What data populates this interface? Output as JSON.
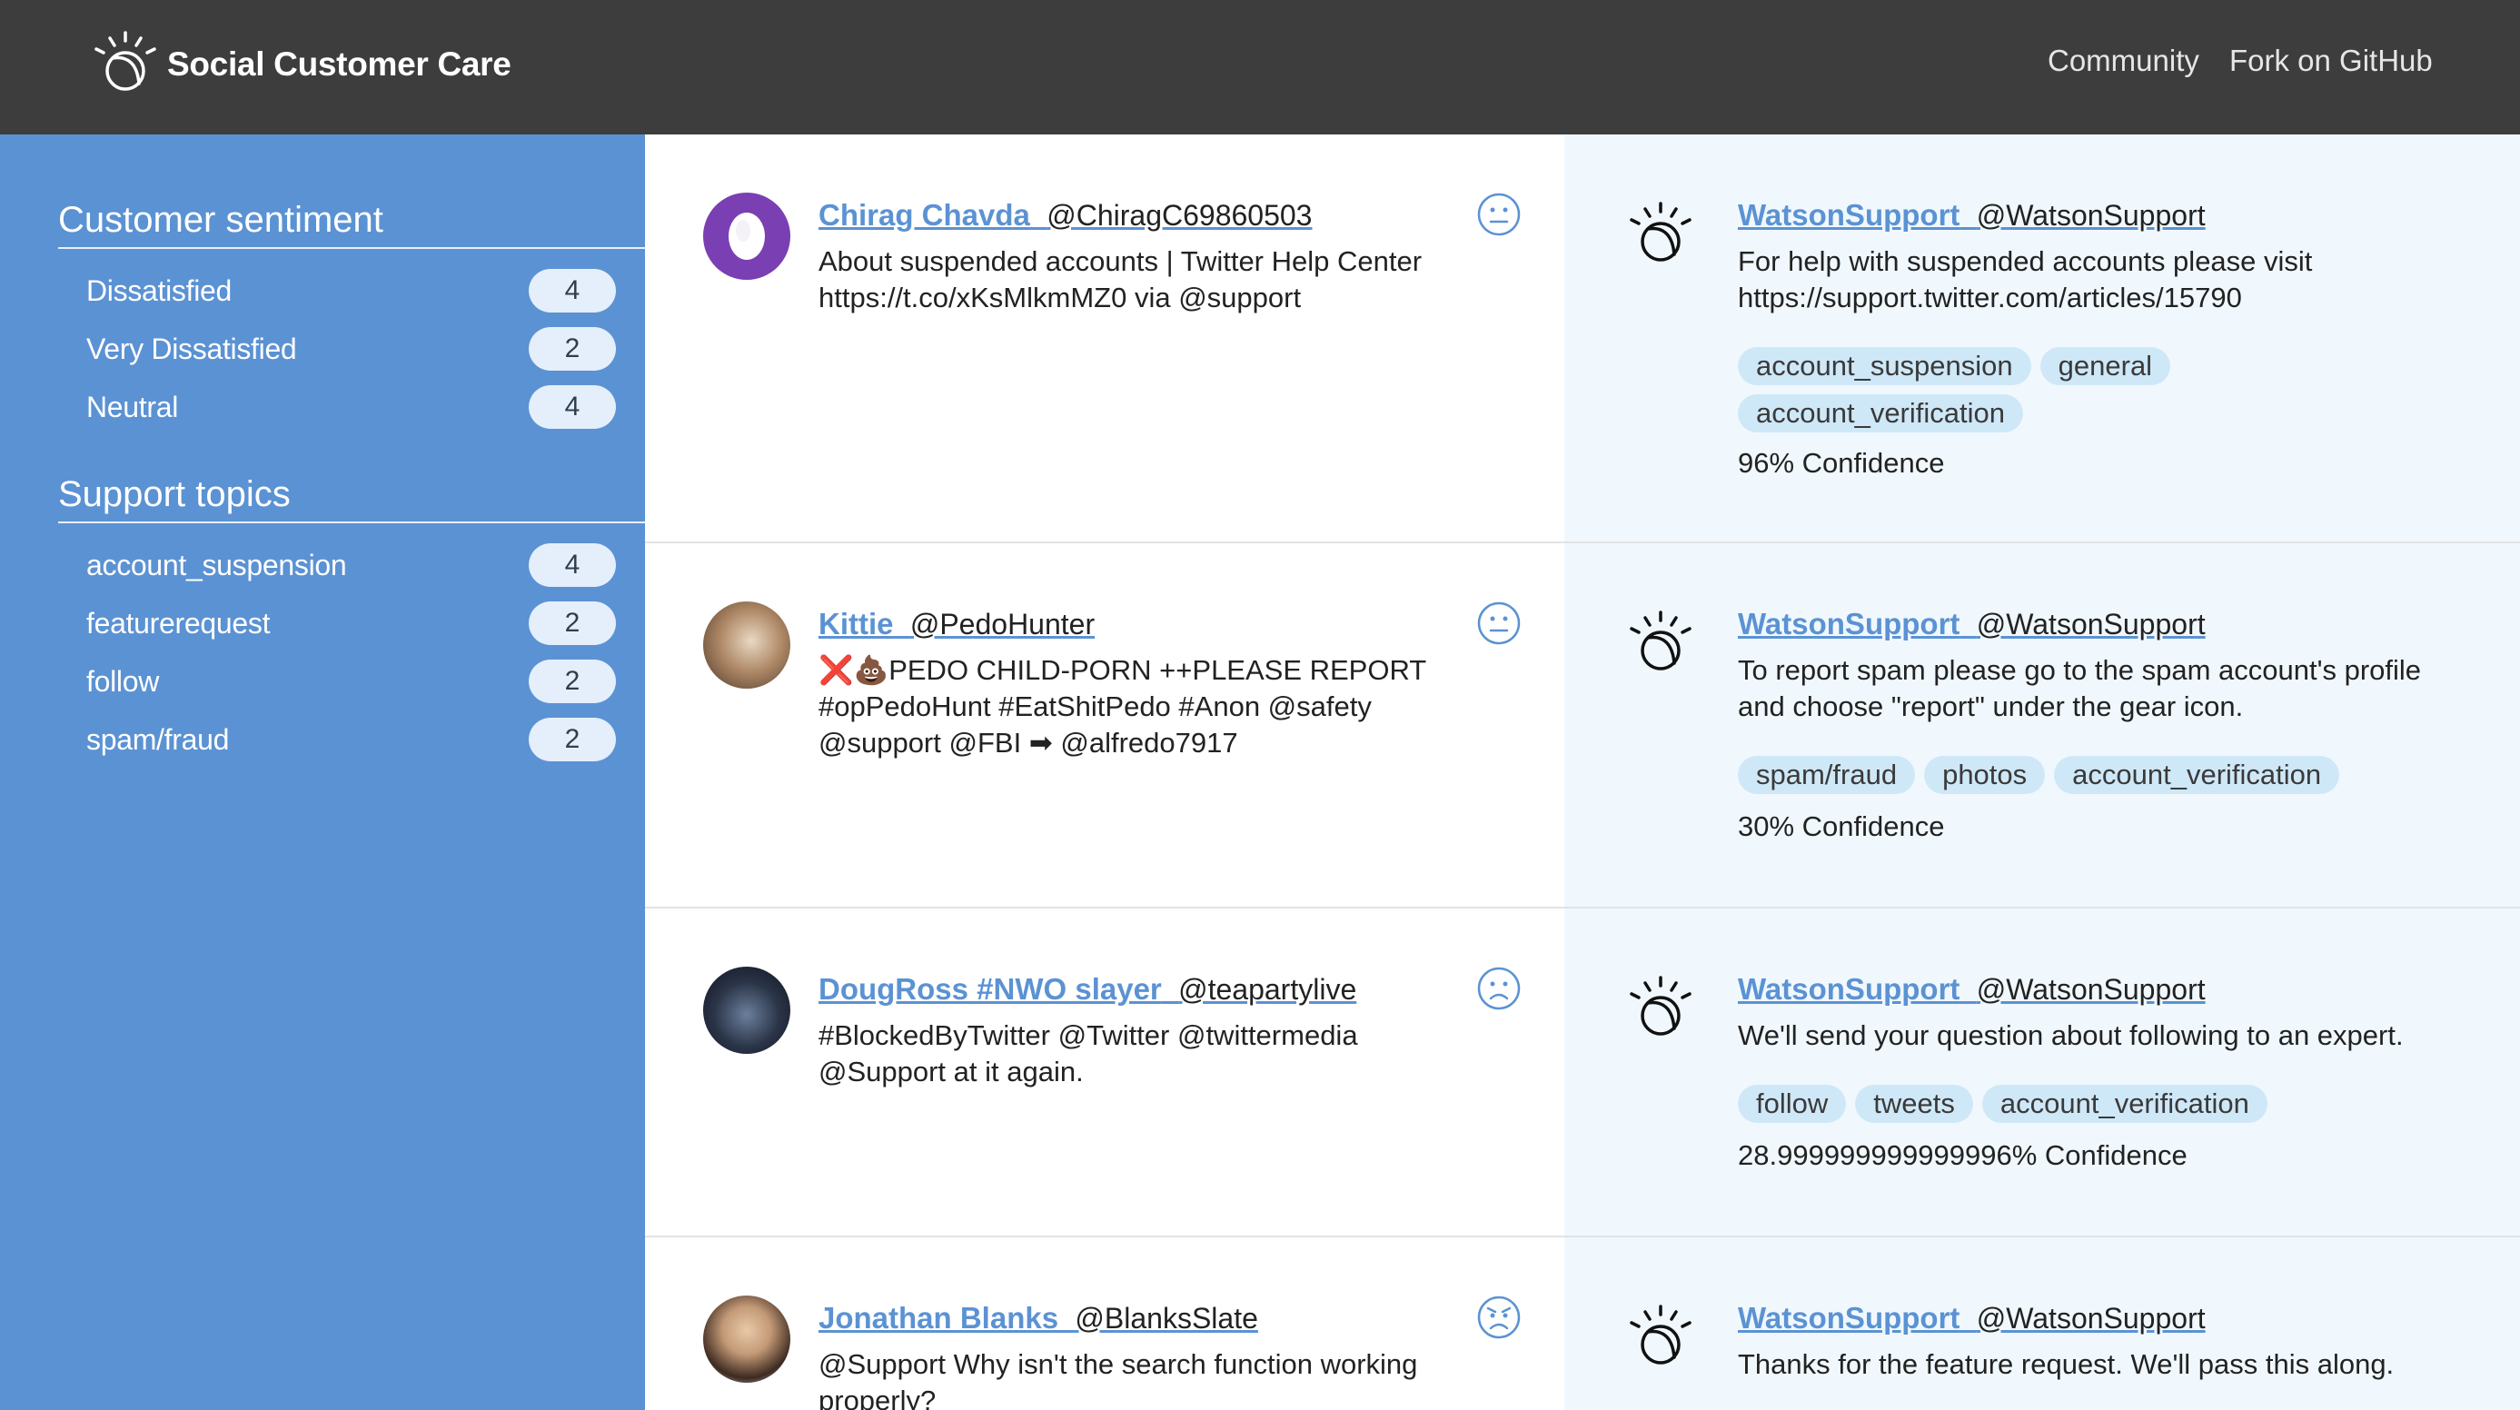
{
  "header": {
    "title": "Social Customer Care",
    "logo_icon": "watson-logo-icon",
    "links": [
      "Community",
      "Fork on GitHub"
    ]
  },
  "sidebar": {
    "sentiment_title": "Customer sentiment",
    "sentiment_items": [
      {
        "label": "Dissatisfied",
        "count": "4"
      },
      {
        "label": "Very Dissatisfied",
        "count": "2"
      },
      {
        "label": "Neutral",
        "count": "4"
      }
    ],
    "topics_title": "Support topics",
    "topic_items": [
      {
        "label": "account_suspension",
        "count": "4"
      },
      {
        "label": "featurerequest",
        "count": "2"
      },
      {
        "label": "follow",
        "count": "2"
      },
      {
        "label": "spam/fraud",
        "count": "2"
      }
    ]
  },
  "colors": {
    "header_bg": "#3d3d3d",
    "sidebar_bg": "#5b92d3",
    "link": "#5b92d3",
    "response_bg": "#f0f8fd",
    "tag_bg": "#cfe8f8"
  },
  "tweets": [
    {
      "name": "Chirag Chavda",
      "handle": "@ChiragC69860503",
      "text_lines": [
        "About suspended accounts | Twitter Help Center",
        "https://t.co/xKsMlkmMZ0 via @support"
      ],
      "sentiment_icon": "neutral-face-icon",
      "response": {
        "name": "WatsonSupport",
        "handle": "@WatsonSupport",
        "text_lines": [
          "For help with suspended accounts please visit",
          "https://support.twitter.com/articles/15790"
        ],
        "tags": [
          "account_suspension",
          "general",
          "account_verification"
        ],
        "confidence": "96% Confidence"
      }
    },
    {
      "name": "Kittie",
      "handle": "@PedoHunter",
      "text_lines": [
        "❌💩PEDO CHILD-PORN ++PLEASE REPORT",
        "#opPedoHunt #EatShitPedo #Anon @safety",
        "@support @FBI ➡ @alfredo7917"
      ],
      "sentiment_icon": "neutral-face-icon",
      "response": {
        "name": "WatsonSupport",
        "handle": "@WatsonSupport",
        "text_lines": [
          "To report spam please go to the spam account's profile",
          "and choose \"report\" under the gear icon."
        ],
        "tags": [
          "spam/fraud",
          "photos",
          "account_verification"
        ],
        "confidence": "30% Confidence"
      }
    },
    {
      "name": "DougRoss #NWO slayer",
      "handle": "@teapartylive",
      "text_lines": [
        "#BlockedByTwitter @Twitter @twittermedia",
        "@Support at it again."
      ],
      "sentiment_icon": "sad-face-icon",
      "response": {
        "name": "WatsonSupport",
        "handle": "@WatsonSupport",
        "text_lines": [
          "We'll send your question about following to an expert."
        ],
        "tags": [
          "follow",
          "tweets",
          "account_verification"
        ],
        "confidence": "28.999999999999996% Confidence"
      }
    },
    {
      "name": "Jonathan Blanks",
      "handle": "@BlanksSlate",
      "text_lines": [
        "@Support Why isn't the search function working",
        "properly?"
      ],
      "sentiment_icon": "angry-face-icon",
      "response": {
        "name": "WatsonSupport",
        "handle": "@WatsonSupport",
        "text_lines": [
          "Thanks for the feature request. We'll pass this along."
        ],
        "tags": [],
        "confidence": ""
      }
    }
  ]
}
